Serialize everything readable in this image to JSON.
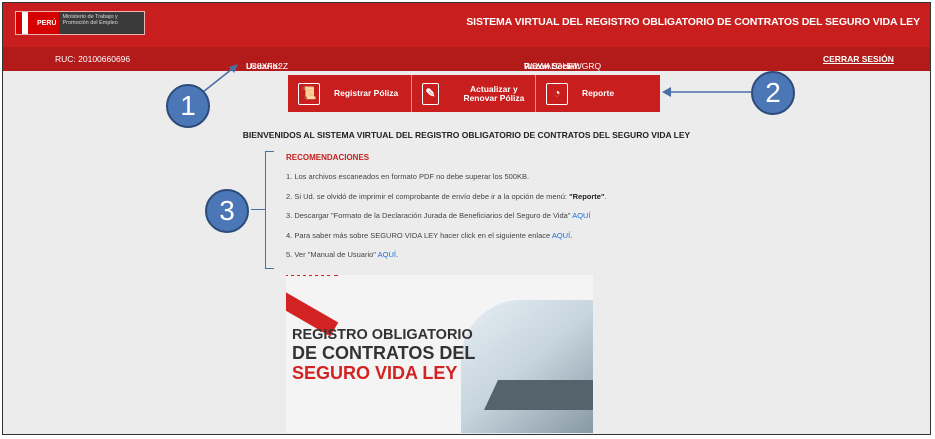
{
  "header": {
    "logo": {
      "country": "PERÚ",
      "ministry": "Ministerio de Trabajo y Promoción del Empleo"
    },
    "title": "SISTEMA VIRTUAL DEL REGISTRO OBLIGATORIO DE CONTRATOS DEL SEGURO VIDA LEY"
  },
  "infobar": {
    "ruc": "RUC: 20100660696",
    "usuario_label": "Usuario:",
    "usuario_value": "LC8XFK2Z",
    "razon_label": "Razón Social:",
    "razon_value": "WSWALGHFWGRQ",
    "logout": "CERRAR SESIÓN"
  },
  "menu": [
    {
      "label": "Registrar Póliza",
      "icon": "scroll-document-icon"
    },
    {
      "label": "Actualizar y Renovar Póliza",
      "icon": "edit-document-icon"
    },
    {
      "label": "Reporte",
      "icon": "report-chart-icon"
    }
  ],
  "welcome": "BIENVENIDOS AL SISTEMA VIRTUAL DEL REGISTRO OBLIGATORIO DE CONTRATOS DEL SEGURO VIDA LEY",
  "recommendations": {
    "title": "RECOMENDACIONES",
    "item1": "1. Los archivos escaneados en formato PDF no debe superar los 500KB.",
    "item2_pre": "2. Si Ud. se olvidó de imprimir el comprobante de envío debe ir a la opción de menú: ",
    "item2_strong": "\"Reporte\"",
    "item2_post": ".",
    "item3_pre": "3. Descargar \"Formato de la Declaración Jurada de Beneficiarios del Seguro de Vida\" ",
    "item4_pre": "4. Para saber más sobre SEGURO VIDA LEY hacer click en el siguiente enlace ",
    "item5_pre": "5. Ver \"Manual de Usuario\" ",
    "link": "AQUÍ",
    "link_dot": "."
  },
  "banner": {
    "line1": "REGISTRO OBLIGATORIO",
    "line2": "DE CONTRATOS DEL",
    "line3": "SEGURO VIDA LEY"
  },
  "annotations": {
    "one": "1",
    "two": "2",
    "three": "3"
  },
  "colors": {
    "brand_red": "#c81e1e",
    "annotation_blue": "#4b77b7",
    "link_blue": "#1a6fd6"
  }
}
